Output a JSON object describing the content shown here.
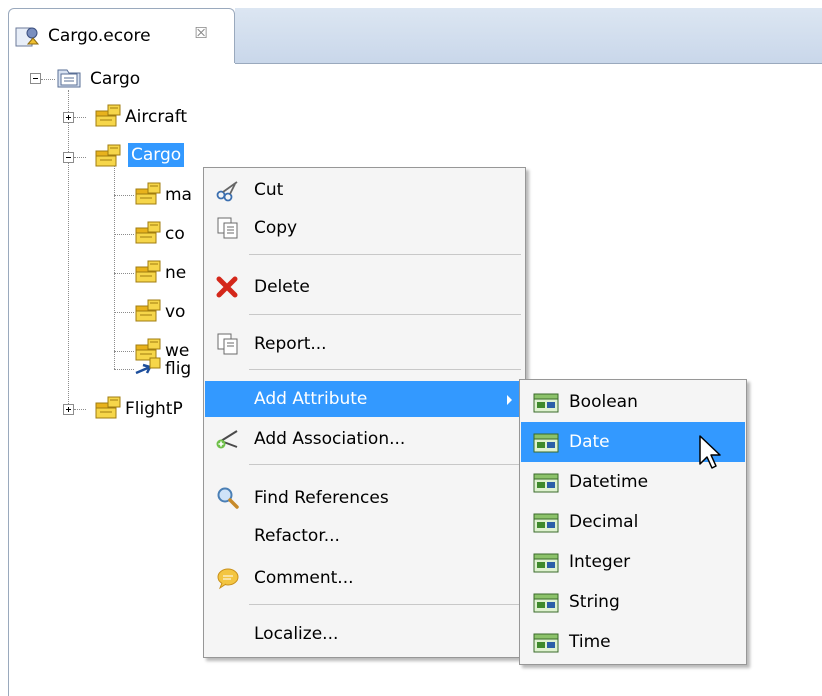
{
  "editor_tab": {
    "label": "Cargo.ecore",
    "close_glyph": "☒"
  },
  "tree": {
    "root": {
      "label": "Cargo",
      "icon": "package-icon"
    },
    "nodes": [
      {
        "label": "Aircraft",
        "icon": "eclass-icon",
        "expanded": false
      },
      {
        "label": "Cargo",
        "icon": "eclass-icon",
        "expanded": true,
        "selected": true
      },
      {
        "label": "FlightP",
        "icon": "eclass-icon",
        "expanded": false
      }
    ],
    "children": [
      {
        "label": "ma",
        "icon": "eclass-icon"
      },
      {
        "label": "co",
        "icon": "eclass-icon"
      },
      {
        "label": "ne",
        "icon": "eclass-icon"
      },
      {
        "label": "vo",
        "icon": "eclass-icon"
      },
      {
        "label": "we",
        "icon": "eclass-icon"
      },
      {
        "label": "flig",
        "icon": "reference-icon"
      }
    ]
  },
  "context_menu": {
    "items": [
      {
        "label": "Cut",
        "icon": "scissors-icon"
      },
      {
        "label": "Copy",
        "icon": "copy-icon"
      },
      {
        "label": "Delete",
        "icon": "delete-icon"
      },
      {
        "label": "Report...",
        "icon": "report-icon"
      },
      {
        "label": "Add Attribute",
        "icon": "",
        "submenu": true,
        "highlighted": true
      },
      {
        "label": "Add Association...",
        "icon": "add-association-icon"
      },
      {
        "label": "Find References",
        "icon": "magnifier-icon"
      },
      {
        "label": "Refactor...",
        "icon": ""
      },
      {
        "label": "Comment...",
        "icon": "comment-icon"
      },
      {
        "label": "Localize...",
        "icon": ""
      }
    ]
  },
  "attribute_submenu": {
    "items": [
      {
        "label": "Boolean",
        "icon": "attribute-icon"
      },
      {
        "label": "Date",
        "icon": "attribute-icon",
        "highlighted": true
      },
      {
        "label": "Datetime",
        "icon": "attribute-icon"
      },
      {
        "label": "Decimal",
        "icon": "attribute-icon"
      },
      {
        "label": "Integer",
        "icon": "attribute-icon"
      },
      {
        "label": "String",
        "icon": "attribute-icon"
      },
      {
        "label": "Time",
        "icon": "attribute-icon"
      }
    ]
  },
  "colors": {
    "selection": "#3399ff",
    "menu_bg": "#f5f5f5",
    "menu_border": "#979797",
    "tab_strip": "#dce6f2"
  }
}
